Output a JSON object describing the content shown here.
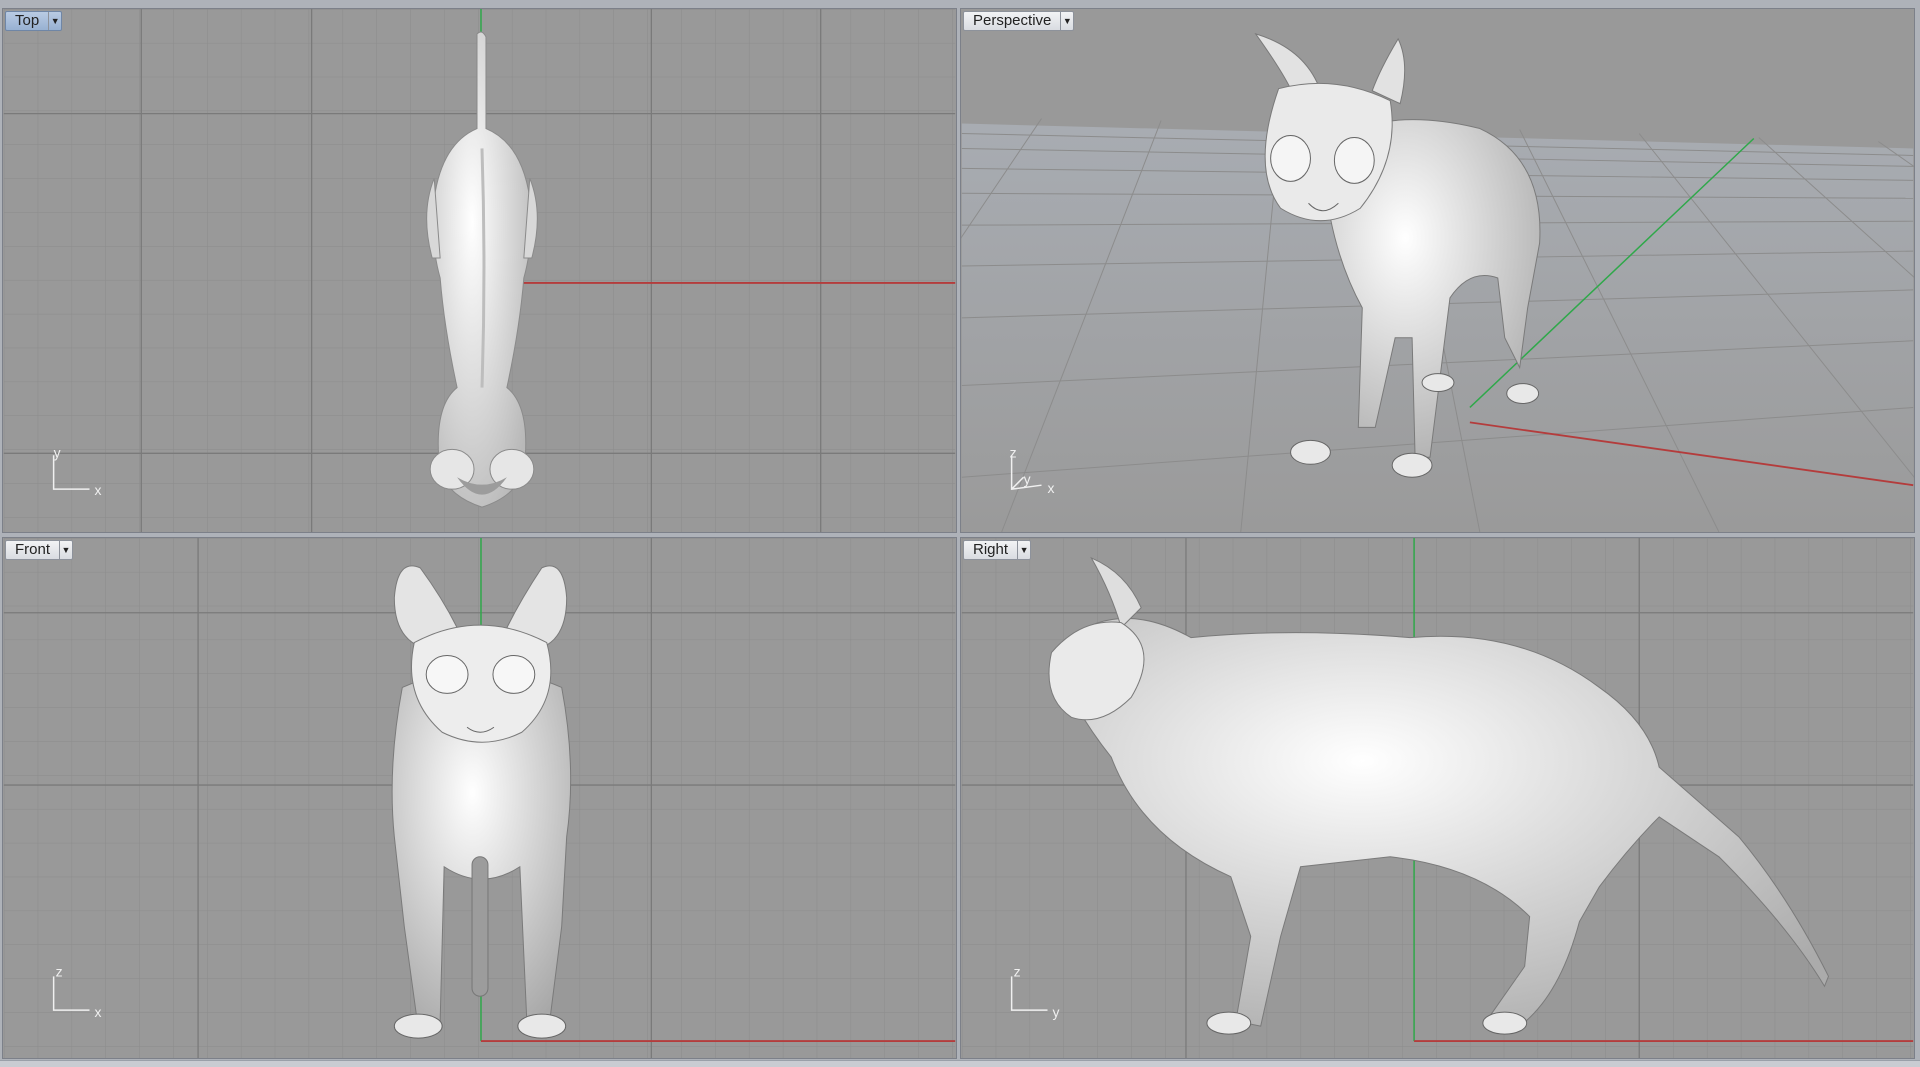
{
  "viewports": {
    "top": {
      "label": "Top",
      "axis": {
        "h": "x",
        "v": "y"
      }
    },
    "persp": {
      "label": "Perspective",
      "axis": {
        "h": "x",
        "v": "z",
        "d": "y"
      }
    },
    "front": {
      "label": "Front",
      "axis": {
        "h": "x",
        "v": "z"
      }
    },
    "right": {
      "label": "Right",
      "axis": {
        "h": "y",
        "v": "z"
      }
    }
  },
  "menu_icon": "dropdown-arrow-icon",
  "colors": {
    "viewport_bg": "#999999",
    "grid_minor": "#8c8c8c",
    "grid_major": "#808080",
    "x_axis": "#b43c3c",
    "y_axis": "#2fa84a",
    "model": "#ededed",
    "active_tab": "#a8bedc"
  }
}
